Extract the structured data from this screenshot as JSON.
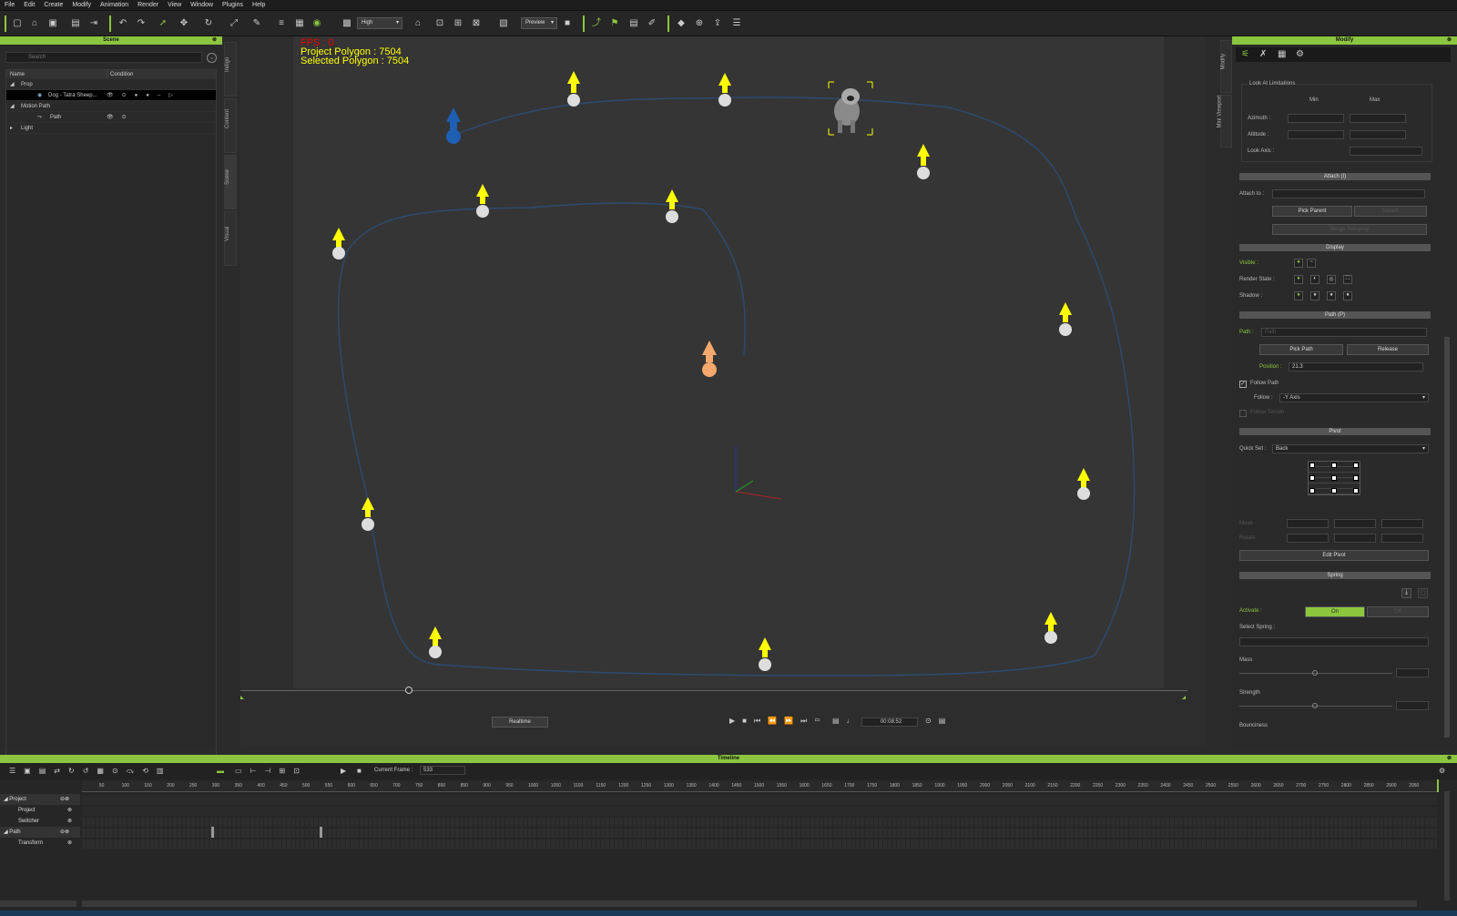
{
  "menu": [
    "File",
    "Edit",
    "Create",
    "Modify",
    "Animation",
    "Render",
    "View",
    "Window",
    "Plugins",
    "Help"
  ],
  "toolbar": {
    "quality": "High",
    "preview": "Preview"
  },
  "scene": {
    "title": "Scene",
    "search_placeholder": "Search",
    "columns": {
      "name": "Name",
      "condition": "Condition"
    },
    "rows": [
      {
        "label": "Prop"
      },
      {
        "label": "Dog - Tatra Sheep..."
      },
      {
        "label": "Motion Path"
      },
      {
        "label": "Path"
      },
      {
        "label": "Light"
      }
    ]
  },
  "side_tabs": [
    "Indigo",
    "Content",
    "Scene",
    "Visual"
  ],
  "hud": {
    "fps": "FPS : 0",
    "project_polygon": "Project Polygon : 7504",
    "selected_polygon": "Selected Polygon : 7504"
  },
  "playback": {
    "realtime": "Realtime",
    "time": "00:08:52",
    "slider_position": 0.18
  },
  "modify": {
    "title": "Modify",
    "side_tabs": [
      "Modify",
      "Mini Viewport"
    ],
    "look_at_limitations": "Look At Limitations",
    "min": "Min",
    "max": "Max",
    "azimuth": "Azimuth :",
    "altitude": "Altitude :",
    "look_axis": "Look Axis :",
    "attach_section": "Attach (I)",
    "attach_to": "Attach to :",
    "pick_parent": "Pick Parent",
    "detach": "Detach",
    "merge_sub_prop": "Merge Sub-prop",
    "display_section": "Display",
    "visible": "Visible :",
    "render_state": "Render State :",
    "shadow": "Shadow :",
    "path_section": "Path (P)",
    "path_label": "Path :",
    "path_placeholder": "Path",
    "pick_path": "Pick Path",
    "release": "Release",
    "position_label": "Position :",
    "position_value": "21.3",
    "follow_path": "Follow Path",
    "follow_label": "Follow :",
    "follow_value": "-Y Axis",
    "follow_terrain": "Follow Terrain",
    "pivot_section": "Pivot",
    "quick_set_label": "Quick Set :",
    "quick_set_value": "Back",
    "move": "Move",
    "rotate": "Rotate",
    "edit_pivot": "Edit Pivot",
    "spring_section": "Spring",
    "activate": "Activate :",
    "on": "On",
    "off": "Off",
    "select_spring": "Select Spring :",
    "mass": "Mass",
    "strength": "Strength",
    "bounciness": "Bounciness"
  },
  "timeline": {
    "title": "Timeline",
    "current_frame_label": "Current Frame :",
    "current_frame": "533",
    "ruler": [
      "50",
      "100",
      "150",
      "200",
      "250",
      "300",
      "350",
      "400",
      "450",
      "500",
      "550",
      "600",
      "650",
      "700",
      "750",
      "800",
      "850",
      "900",
      "950",
      "1000",
      "1050",
      "1100",
      "1150",
      "1200",
      "1250",
      "1300",
      "1350",
      "1400",
      "1450",
      "1500",
      "1550",
      "1600",
      "1650",
      "1700",
      "1750",
      "1800",
      "1850",
      "1900",
      "1950",
      "2000",
      "2050",
      "2100",
      "2150",
      "2200",
      "2250",
      "2300",
      "2350",
      "2400",
      "2450",
      "2500",
      "2550",
      "2600",
      "2650",
      "2700",
      "2750",
      "2800",
      "2850",
      "2900",
      "2950"
    ],
    "tracks": [
      {
        "label": "Project"
      },
      {
        "label": "Project"
      },
      {
        "label": "Switcher"
      },
      {
        "label": "Path"
      },
      {
        "label": "Transform"
      }
    ]
  },
  "colors": {
    "accent": "#8cc63f",
    "path_line": "#2d4a6e",
    "arrow": "#ffff00",
    "start_marker": "#1e5fb4",
    "current_marker": "#f5a86b"
  },
  "icons": [
    "new-icon",
    "open-icon",
    "save-icon",
    "undo-icon",
    "redo-icon",
    "select-icon",
    "move-icon",
    "rotate-icon",
    "scale-icon",
    "camera-icon",
    "flag-icon",
    "zoom-icon"
  ]
}
